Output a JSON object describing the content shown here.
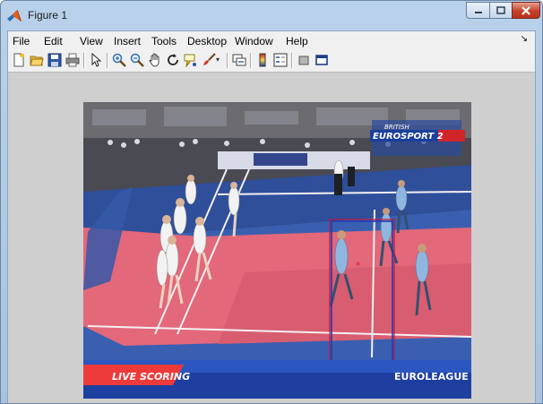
{
  "window": {
    "title": "Figure 1",
    "controls": {
      "minimize": "minimize",
      "maximize": "maximize",
      "close": "close"
    }
  },
  "menu": {
    "items": [
      "File",
      "Edit",
      "View",
      "Insert",
      "Tools",
      "Desktop",
      "Window",
      "Help"
    ]
  },
  "toolbar": {
    "buttons": [
      "new-figure-icon",
      "open-file-icon",
      "save-figure-icon",
      "print-figure-icon",
      "edit-plot-arrow-icon",
      "zoom-in-icon",
      "zoom-out-icon",
      "pan-hand-icon",
      "rotate-3d-icon",
      "data-cursor-icon",
      "brush-icon",
      "link-plot-icon",
      "insert-colorbar-icon",
      "insert-legend-icon",
      "hide-plot-tools-icon",
      "show-plot-tools-icon"
    ]
  },
  "figure": {
    "overlay": {
      "broadcaster_small": "BRITISH",
      "broadcaster": "EUROSPORT 2",
      "live_banner": "LIVE SCORING",
      "league": "EUROLEAGUE"
    },
    "detection": {
      "box_color": "#c0143c",
      "marker": "*"
    },
    "colors": {
      "court": "#e2687a",
      "out_of_bounds": "#3a5fb0",
      "team_jersey": "#8fb6df"
    }
  }
}
